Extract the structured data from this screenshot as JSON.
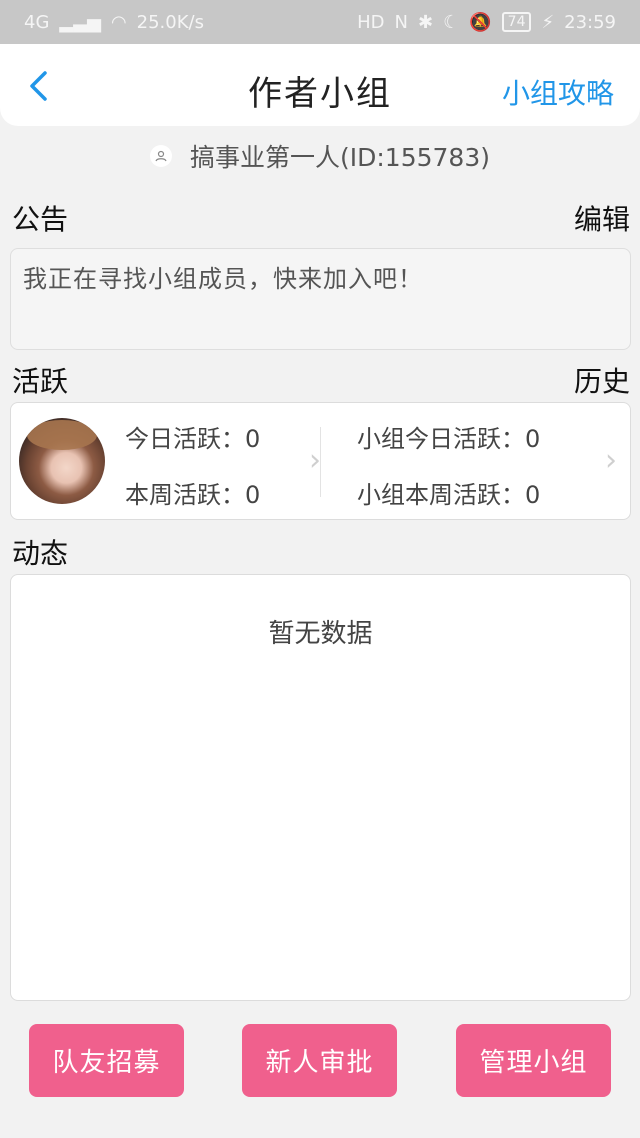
{
  "status_bar": {
    "network": "4G",
    "speed": "25.0K/s",
    "battery": "74",
    "time": "23:59"
  },
  "header": {
    "title": "作者小组",
    "guide": "小组攻略"
  },
  "owner": {
    "name_id": "搞事业第一人(ID:155783)"
  },
  "notice": {
    "title": "公告",
    "edit": "编辑",
    "content": "我正在寻找小组成员，快来加入吧！"
  },
  "activity": {
    "title": "活跃",
    "history": "历史",
    "today": "今日活跃：0",
    "week": "本周活跃：0",
    "group_today": "小组今日活跃：0",
    "group_week": "小组本周活跃：0"
  },
  "feed": {
    "title": "动态",
    "empty": "暂无数据"
  },
  "actions": {
    "recruit": "队友招募",
    "approve": "新人审批",
    "manage": "管理小组"
  },
  "colors": {
    "accent_blue": "#2196e8",
    "button_pink": "#f0608d"
  }
}
